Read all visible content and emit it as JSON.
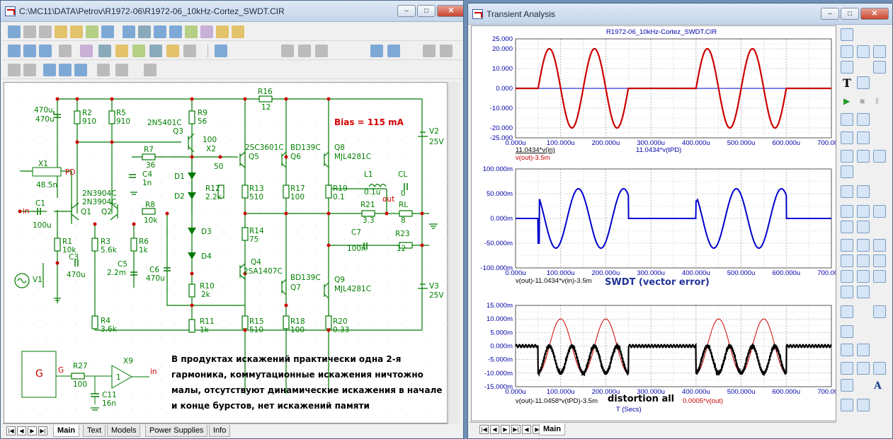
{
  "schematic_window": {
    "title": "C:\\MC11\\DATA\\Petrov\\R1972-06\\R1972-06_10kHz-Cortez_SWDT.CIR",
    "bias_note": "Bias = 115 mA",
    "comment_lines": [
      "В продуктах искажений практически одна 2-я",
      "гармоника, коммутационные искажения ничтожно",
      "малы, отсутствуют динамические искажения в начале",
      "и конце бурстов, нет искажений памяти"
    ],
    "tabs": [
      "Main",
      "Text",
      "Models",
      "Power Supplies",
      "Info"
    ],
    "components": {
      "R2": "910",
      "R5": "910",
      "R9": "56",
      "R16": "12",
      "R7": "36",
      "X2": "50",
      "R12": "2.2k",
      "R13": "510",
      "R17": "100",
      "R19": "0.1",
      "R21": "3.3",
      "RL": "8",
      "L1": "0.1u",
      "CL": "0",
      "C7": "100n",
      "R23": "12",
      "R14": "75",
      "R10": "2k",
      "R11": "1k",
      "R15": "510",
      "R18": "100",
      "R20": "0.33",
      "R8": "10k",
      "R1": "10k",
      "R3": "5.6k",
      "R6": "1k",
      "R4": "3.6k",
      "C1": "100u",
      "C2": "470u",
      "C3": "470u",
      "C4": "1n",
      "C5": "2.2m",
      "C6": "470u",
      "X1": "48.5n",
      "V2": "25V",
      "V3": "25V",
      "R27": "100",
      "C11": "16n",
      "G": "G",
      "X9": "1",
      "Q1": "Q1",
      "Q2": "Q2",
      "Q3": "Q3",
      "Q4": "Q4",
      "Q5": "Q5",
      "Q6": "Q6",
      "Q7": "Q7",
      "Q8": "Q8",
      "Q9": "Q9",
      "Q3_model": "2N5401C",
      "Q1_model": "2N3904C",
      "Q2_model": "2N3904C",
      "Q5_model": "2SC3601C",
      "Q6_model": "BD139C",
      "Q8_model": "MJL4281C",
      "Q4_model": "2SA1407C",
      "Q7_model": "BD139C",
      "Q9_model": "MJL4281C",
      "D1": "D1",
      "D2": "D2",
      "D3": "D3",
      "D4": "D4",
      "V1": "V1",
      "in": "in",
      "out": "out",
      "PD": "PD",
      "X1_label": "X1"
    }
  },
  "transient_window": {
    "title": "Transient Analysis",
    "tab": "Main",
    "plot_title": "R1972-06_10kHz-Cortez_SWDT.CIR",
    "xticks": [
      "0.000u",
      "100.000u",
      "200.000u",
      "300.000u",
      "400.000u",
      "500.000u",
      "600.000u",
      "700.000u"
    ],
    "x_axis_label": "T (Secs)",
    "plot1": {
      "yticks": [
        "25.000",
        "20.000",
        "10.000",
        "0.000",
        "-10.000",
        "-20.000",
        "-25.000"
      ],
      "legend": [
        "11.0434*v(in)",
        "v(out)-3.5m",
        "11.0434*v(tPD)"
      ]
    },
    "plot2": {
      "yticks": [
        "100.000m",
        "50.000m",
        "0.000m",
        "-50.000m",
        "-100.000m"
      ],
      "legend": [
        "v(out)-11.0434*v(in)-3.5m"
      ],
      "note": "SWDT (vector error)"
    },
    "plot3": {
      "yticks": [
        "15.000m",
        "10.000m",
        "5.000m",
        "0.000m",
        "-5.000m",
        "-10.000m",
        "-15.000m"
      ],
      "legend": [
        "v(out)-11.0458*v(tPD)-3.5m",
        "0.0005*v(out)"
      ],
      "note": "distortion all"
    }
  },
  "chart_data": [
    {
      "type": "line",
      "title": "R1972-06_10kHz-Cortez_SWDT.CIR",
      "xlim": [
        0,
        700
      ],
      "ylim": [
        -25,
        25
      ],
      "series": [
        {
          "name": "11.0434*v(in)",
          "color": "#0000cc"
        },
        {
          "name": "v(out)-3.5m",
          "color": "#cc0000"
        },
        {
          "name": "11.0434*v(tPD)",
          "color": "#0000cc"
        }
      ],
      "bursts": [
        [
          50,
          250
        ],
        [
          400,
          600
        ]
      ],
      "amplitude": 20,
      "frequency_khz": 10
    },
    {
      "type": "line",
      "xlim": [
        0,
        700
      ],
      "ylim": [
        -100,
        100
      ],
      "series": [
        {
          "name": "v(out)-11.0434*v(in)-3.5m",
          "color": "#0000cc"
        }
      ],
      "bursts": [
        [
          50,
          250
        ],
        [
          400,
          600
        ]
      ],
      "amplitude": 60
    },
    {
      "type": "line",
      "xlim": [
        0,
        700
      ],
      "ylim": [
        -15,
        15
      ],
      "series": [
        {
          "name": "v(out)-11.0458*v(tPD)-3.5m",
          "color": "#000000"
        },
        {
          "name": "0.0005*v(out)",
          "color": "#cc0000"
        }
      ],
      "bursts": [
        [
          50,
          250
        ],
        [
          400,
          600
        ]
      ]
    }
  ],
  "colors": {
    "wire": "#007a00",
    "node": "#cc0000",
    "text": "#008000",
    "grid": "#9a9a9a"
  },
  "icons": {
    "schematic_toolbar": [
      "select-icon",
      "wire-icon",
      "text-icon",
      "flag-icon",
      "component-icon",
      "library-icon",
      "help-icon",
      "probe-icon",
      "grid-icon"
    ],
    "side_toolbar": [
      "scale-icon",
      "cursor-icon",
      "run-icon",
      "stop-icon",
      "zoom-in-icon",
      "zoom-out-icon",
      "text-tool-icon"
    ]
  }
}
